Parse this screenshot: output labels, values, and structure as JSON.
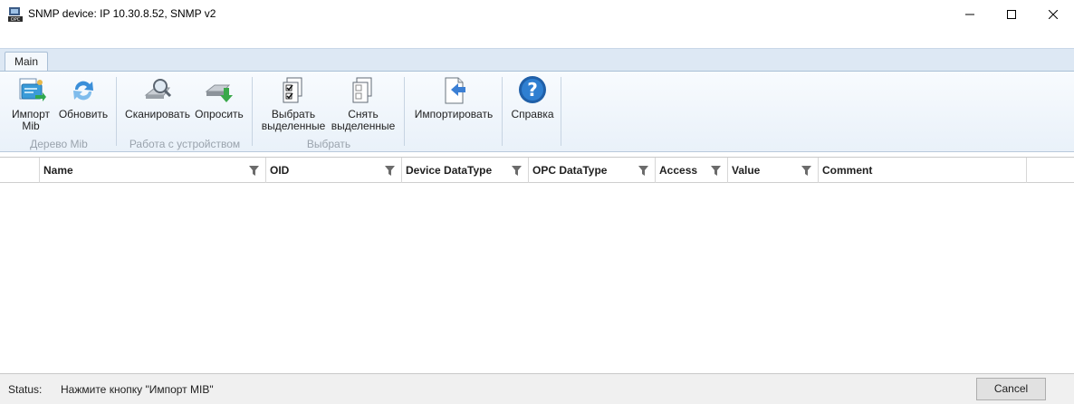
{
  "window": {
    "title": "SNMP device: IP 10.30.8.52, SNMP v2"
  },
  "ribbon": {
    "tabs": [
      {
        "label": "Main"
      }
    ],
    "groups": [
      {
        "label": "Дерево Mib",
        "buttons": [
          {
            "label_line1": "Импорт",
            "label_line2": "Mib",
            "icon": "import-mib-icon"
          },
          {
            "label_line1": "Обновить",
            "label_line2": "",
            "icon": "refresh-icon"
          }
        ]
      },
      {
        "label": "Работа с устройством",
        "buttons": [
          {
            "label_line1": "Сканировать",
            "label_line2": "",
            "icon": "scan-icon"
          },
          {
            "label_line1": "Опросить",
            "label_line2": "",
            "icon": "poll-icon"
          }
        ]
      },
      {
        "label": "Выбрать",
        "buttons": [
          {
            "label_line1": "Выбрать",
            "label_line2": "выделенные",
            "icon": "check-selected-icon"
          },
          {
            "label_line1": "Снять",
            "label_line2": "выделенные",
            "icon": "uncheck-selected-icon"
          }
        ]
      },
      {
        "label": "",
        "buttons": [
          {
            "label_line1": "Импортировать",
            "label_line2": "",
            "icon": "import-icon"
          }
        ]
      },
      {
        "label": "",
        "buttons": [
          {
            "label_line1": "Справка",
            "label_line2": "",
            "icon": "help-icon"
          }
        ]
      }
    ]
  },
  "grid": {
    "columns": [
      {
        "label": "Name",
        "filter": true
      },
      {
        "label": "OID",
        "filter": true
      },
      {
        "label": "Device DataType",
        "filter": true
      },
      {
        "label": "OPC DataType",
        "filter": true
      },
      {
        "label": "Access",
        "filter": true
      },
      {
        "label": "Value",
        "filter": true
      },
      {
        "label": "Comment",
        "filter": false
      }
    ],
    "rows": []
  },
  "status": {
    "label": "Status:",
    "text": "Нажмите кнопку \"Импорт MIB\"",
    "cancel_label": "Cancel"
  },
  "colors": {
    "ribbon_bg": "#e9f1f9",
    "tabstrip_bg": "#dde8f4",
    "status_bg": "#f0f0f0"
  }
}
